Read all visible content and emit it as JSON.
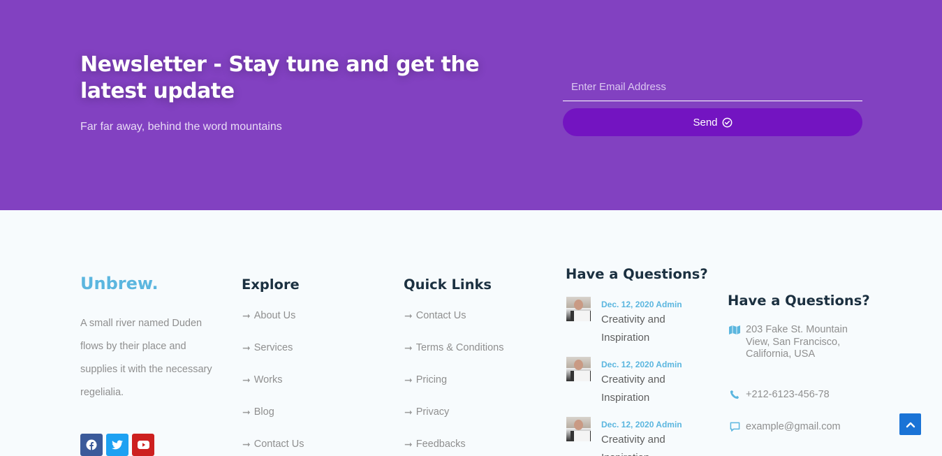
{
  "newsletter": {
    "title": "Newsletter - Stay tune and get the latest update",
    "subtitle": "Far far away, behind the word mountains",
    "email_placeholder": "Enter Email Address",
    "send_label": "Send"
  },
  "footer": {
    "brand": "Unbrew.",
    "about": "A small river named Duden flows by their place and supplies it with the necessary regelialia.",
    "socials": [
      "facebook-icon",
      "twitter-icon",
      "youtube-icon"
    ],
    "explore": {
      "title": "Explore",
      "items": [
        "About Us",
        "Services",
        "Works",
        "Blog",
        "Contact Us"
      ]
    },
    "quick_links": {
      "title": "Quick Links",
      "items": [
        "Contact Us",
        "Terms & Conditions",
        "Pricing",
        "Privacy",
        "Feedbacks"
      ]
    },
    "recent_posts": {
      "title": "Have a Questions?",
      "posts": [
        {
          "meta": "Dec. 12, 2020 Admin",
          "title": "Creativity and Inspiration"
        },
        {
          "meta": "Dec. 12, 2020 Admin",
          "title": "Creativity and Inspiration"
        },
        {
          "meta": "Dec. 12, 2020 Admin",
          "title": "Creativity and Inspiration"
        }
      ]
    },
    "contact": {
      "title": "Have a Questions?",
      "address": "203 Fake St. Mountain View, San Francisco, California, USA",
      "phone": "+212-6123-456-78",
      "email": "example@gmail.com"
    }
  },
  "colors": {
    "newsletter_bg": "#8241c1",
    "send_button": "#7314c1",
    "accent": "#5bb6df",
    "heading": "#1b3040",
    "back_to_top": "#1a73d6"
  }
}
